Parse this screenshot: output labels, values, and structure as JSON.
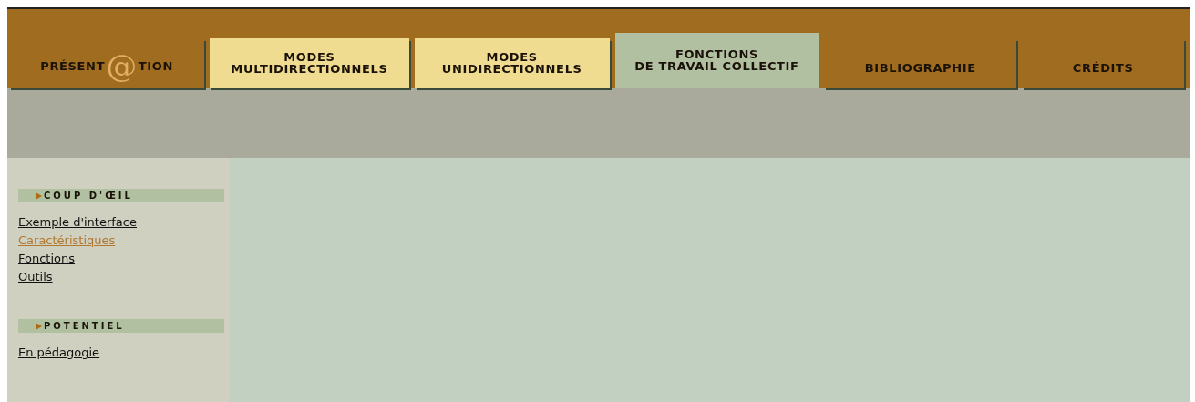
{
  "tabs": [
    {
      "kind": "logo",
      "parts": [
        "PRÉSENT",
        "@",
        "TION"
      ],
      "color": "#a06c20",
      "selected": false
    },
    {
      "kind": "text",
      "parts": [
        "MODES",
        "MULTIDIRECTIONNELS"
      ],
      "color": "#f0dc90",
      "selected": false
    },
    {
      "kind": "text",
      "parts": [
        "MODES",
        "UNIDIRECTIONNELS"
      ],
      "color": "#f0dc90",
      "selected": false
    },
    {
      "kind": "text",
      "parts": [
        "FONCTIONS",
        "DE TRAVAIL COLLECTIF"
      ],
      "color": "#b0c0a0",
      "selected": true
    },
    {
      "kind": "text",
      "parts": [
        "BIBLIOGRAPHIE"
      ],
      "color": "#a06c20",
      "selected": false
    },
    {
      "kind": "text",
      "parts": [
        "CRÉDITS"
      ],
      "color": "#a06c20",
      "selected": false
    }
  ],
  "sidebar": [
    {
      "heading": "COUP D'ŒIL",
      "links": [
        {
          "label": "Exemple d'interface",
          "selected": false
        },
        {
          "label": "Caractéristiques",
          "selected": true
        },
        {
          "label": "Fonctions",
          "selected": false
        },
        {
          "label": "Outils",
          "selected": false
        }
      ]
    },
    {
      "heading": "POTENTIEL",
      "links": [
        {
          "label": "En pédagogie",
          "selected": false
        }
      ]
    }
  ]
}
